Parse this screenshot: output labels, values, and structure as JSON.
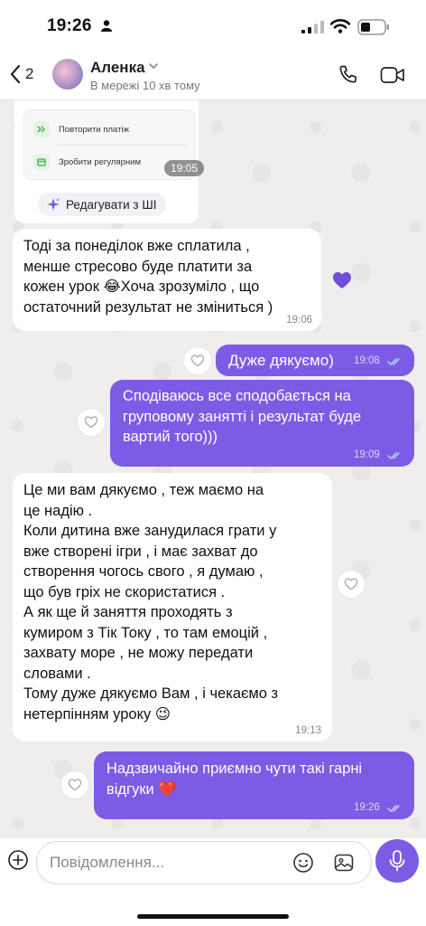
{
  "status_bar": {
    "time": "19:26"
  },
  "header": {
    "back_count": "2",
    "contact_name": "Аленка",
    "contact_status": "В мережі 10 хв тому"
  },
  "card": {
    "row1": "Повторити платіж",
    "row2": "Зробити регулярним",
    "time": "19:05",
    "ai_button": "Редагувати з ШІ"
  },
  "messages": [
    {
      "direction": "in",
      "text": "Тоді за понеділок вже сплатила ,\nменше стресово буде платити за\nкожен урок 😂Хоча зрозуміло , що\nостаточний результат не зміниться )",
      "time": "19:06"
    },
    {
      "direction": "out",
      "text": "Дуже дякуємо)",
      "time": "19:08"
    },
    {
      "direction": "out",
      "text": "Сподіваюсь все сподобається на\nгруповому занятті і результат буде\nвартий того)))",
      "time": "19:09"
    },
    {
      "direction": "in",
      "text": "Це ми вам дякуємо , теж маємо на\nце надію .\nКоли дитина вже занудилася грати у\nвже створені ігри , і має захват до\nстворення чогось свого , я думаю ,\nщо був гріх не скористатися .\nА як ще й заняття проходять з\nкумиром з Тік Току , то там емоцій ,\nзахвату море , не можу передати\nсловами .\nТому дуже дякуємо Вам , і чекаємо з\nнетерпінням уроку 😉",
      "time": "19:13"
    },
    {
      "direction": "out",
      "text": "Надзвичайно приємно чути такі гарні\nвідгуки ❤️",
      "time": "19:26"
    }
  ],
  "input": {
    "placeholder": "Повідомлення..."
  },
  "colors": {
    "accent": "#7c5ce4",
    "background": "#efeeec"
  }
}
